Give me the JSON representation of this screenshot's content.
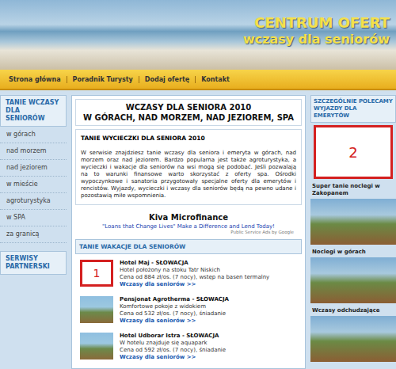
{
  "header": {
    "title": "CENTRUM OFERT",
    "subtitle": "wczasy dla seniorów"
  },
  "nav": [
    "Strona główna",
    "Poradnik Turysty",
    "Dodaj ofertę",
    "Kontakt"
  ],
  "sidebar": {
    "title": "TANIE WCZASY DLA SENIORÓW",
    "items": [
      "w górach",
      "nad morzem",
      "nad jeziorem",
      "w mieście",
      "agroturystyka",
      "w SPA",
      "za granicą"
    ],
    "partners_title": "SERWISY PARTNERSKI"
  },
  "main": {
    "title_lines": [
      "WCZASY DLA SENIORA 2010",
      "W GÓRACH, NAD MORZEM, NAD JEZIOREM, SPA"
    ],
    "intro_title": "TANIE WYCIECZKI DLA SENIORA 2010",
    "intro_text": "W serwisie znajdziesz tanie wczasy dla seniora i emeryta w górach, nad morzem oraz nad jeziorem. Bardzo popularna jest także agroturystyka, a wycieczki i wakacje dla seniorów na wsi mogą się podobać. Jeśli pozwalają na to warunki finansowe warto skorzystać z oferty spa. Ośrodki wypoczynkowe i sanatoria przygotowały specjalne oferty dla emerytów i rencistów. Wyjazdy, wycieczki i wczasy dla seniorów będą na pewno udane i pozostawią miłe wspomnienia.",
    "ad": {
      "title": "Kiva Microfinance",
      "text": "\"Loans that Change Lives\" Make a Difference and Lend Today!",
      "footer": "Public Service Ads by Google"
    },
    "offers_title": "TANIE WAKACJE DLA SENIORÓW",
    "offers": [
      {
        "name": "Hotel Maj - SŁOWACJA",
        "desc": "Hotel położony na stoku Tatr Niskich",
        "price": "Cena od 884 zł/os. (7 nocy), wstęp na basen termalny",
        "link": "Wczasy dla seniorów >>",
        "marker": "1"
      },
      {
        "name": "Pensjonat Agrotherma - SŁOWACJA",
        "desc": "Komfortowe pokoje z widokiem",
        "price": "Cena od 532 zł/os. (7 nocy), śniadanie",
        "link": "Wczasy dla seniorów >>",
        "marker": ""
      },
      {
        "name": "Hotel Udborar Istra - SŁOWACJA",
        "desc": "W hotelu znajduje się aquapark",
        "price": "Cena od 592 zł/os. (7 nocy), śniadanie",
        "link": "Wczasy dla seniorów >>",
        "marker": ""
      }
    ]
  },
  "aside": {
    "title": "SZCZEGÓLNIE POLECAMY WYJAZDY DLA EMERYTÓW",
    "marker": "2",
    "promos": [
      "Super tanie noclegi w Zakopanem",
      "Noclegi w górach",
      "Wczasy odchudzające"
    ]
  }
}
